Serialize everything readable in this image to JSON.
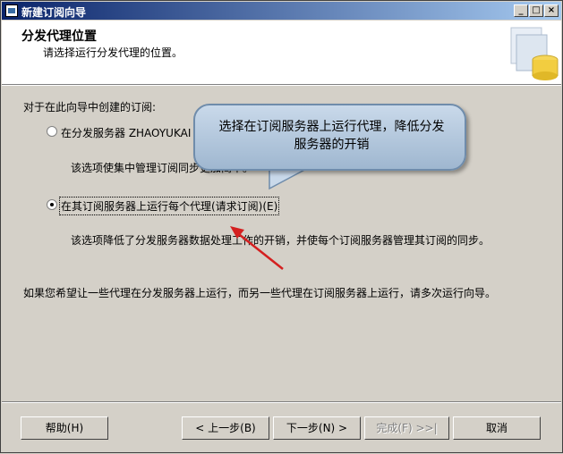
{
  "window": {
    "title": "新建订阅向导",
    "controls": [
      "minimize-icon",
      "maximize-icon",
      "close-icon"
    ]
  },
  "header": {
    "title": "分发代理位置",
    "subtitle": "请选择运行分发代理的位置。"
  },
  "main": {
    "intro": "对于在此向导中创建的订阅:",
    "options": [
      {
        "label": "在分发服务器 ZHAOYUKAI 上运行所有代理(推送订阅)(U)",
        "description": "该选项使集中管理订阅同步更加简单。",
        "selected": false
      },
      {
        "label": "在其订阅服务器上运行每个代理(请求订阅)(E)",
        "description": "该选项降低了分发服务器数据处理工作的开销，并使每个订阅服务器管理其订阅的同步。",
        "selected": true
      }
    ],
    "footnote": "如果您希望让一些代理在分发服务器上运行，而另一些代理在订阅服务器上运行，请多次运行向导。"
  },
  "callout": {
    "text": "选择在订阅服务器上运行代理，降低分发服务器的开销"
  },
  "buttons": {
    "help": "帮助(H)",
    "back": "< 上一步(B)",
    "next": "下一步(N) >",
    "finish": "完成(F) >>|",
    "cancel": "取消"
  }
}
